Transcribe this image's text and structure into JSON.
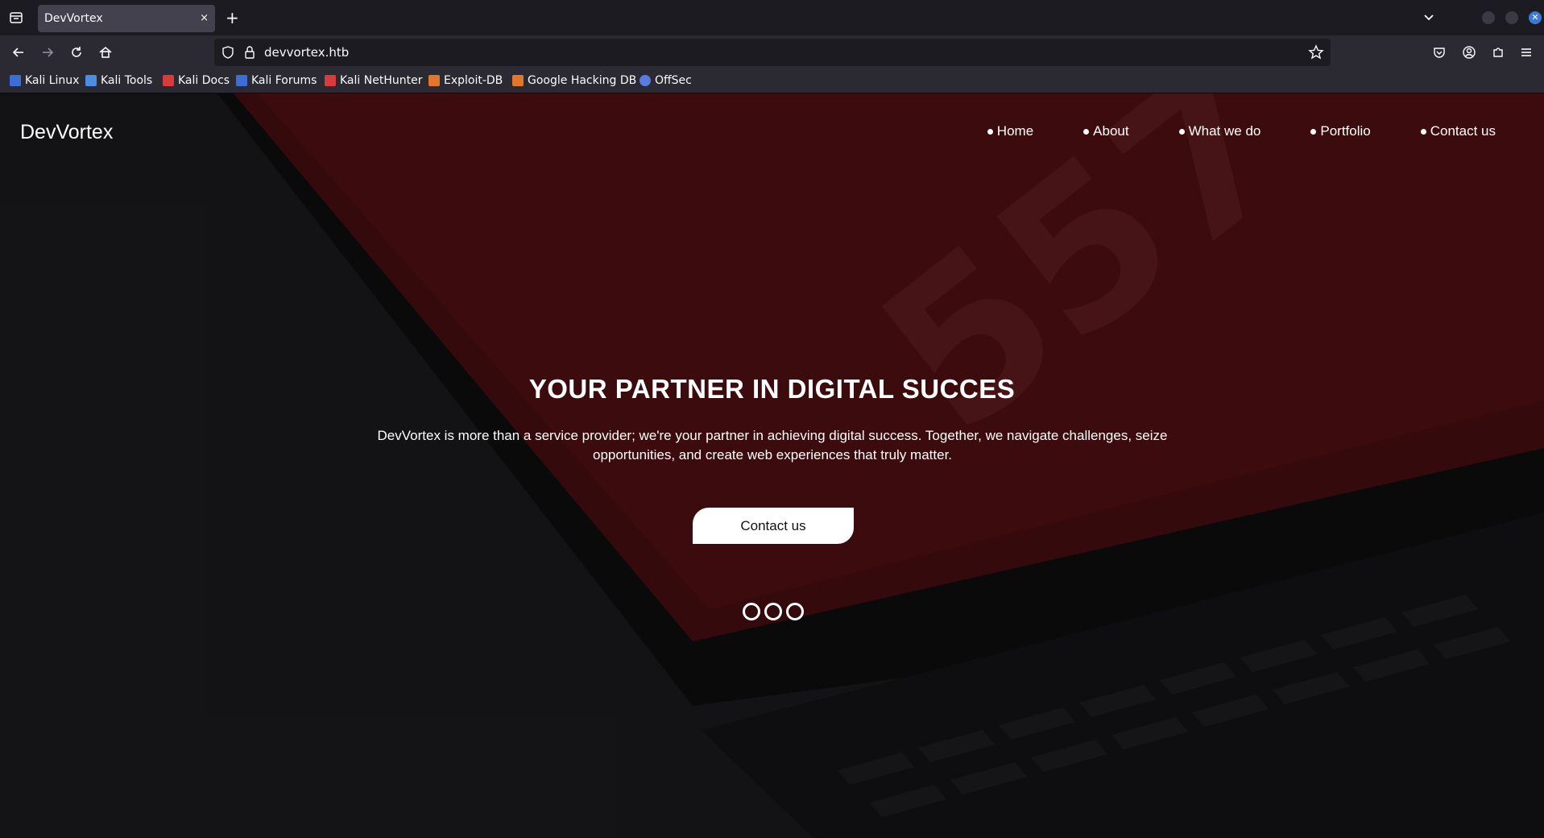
{
  "browser": {
    "tab_title": "DevVortex",
    "tab_close": "×",
    "new_tab": "+",
    "url": "devvortex.htb",
    "bookmarks": [
      {
        "label": "Kali Linux",
        "color": "#3c6fd6"
      },
      {
        "label": "Kali Tools",
        "color": "#4b8de0"
      },
      {
        "label": "Kali Docs",
        "color": "#d63c3c"
      },
      {
        "label": "Kali Forums",
        "color": "#3c6fd6"
      },
      {
        "label": "Kali NetHunter",
        "color": "#d63c3c"
      },
      {
        "label": "Exploit-DB",
        "color": "#e0772b"
      },
      {
        "label": "Google Hacking DB",
        "color": "#e0772b"
      },
      {
        "label": "OffSec",
        "color": "#5a7be0"
      }
    ]
  },
  "site": {
    "brand": "DevVortex",
    "nav": [
      "Home",
      "About",
      "What we do",
      "Portfolio",
      "Contact us"
    ],
    "hero": {
      "title": "YOUR PARTNER IN DIGITAL SUCCES",
      "text": "DevVortex is more than a service provider; we're your partner in achieving digital success. Together, we navigate challenges, seize opportunities, and create web experiences that truly matter.",
      "button": "Contact us",
      "slides": 3
    },
    "background_print": "557"
  },
  "colors": {
    "chrome_dark": "#1c1b22",
    "chrome_mid": "#2b2a33",
    "tab_active": "#42414d",
    "hero_red": "#5a0d10",
    "accent_close": "#3c78d8"
  }
}
